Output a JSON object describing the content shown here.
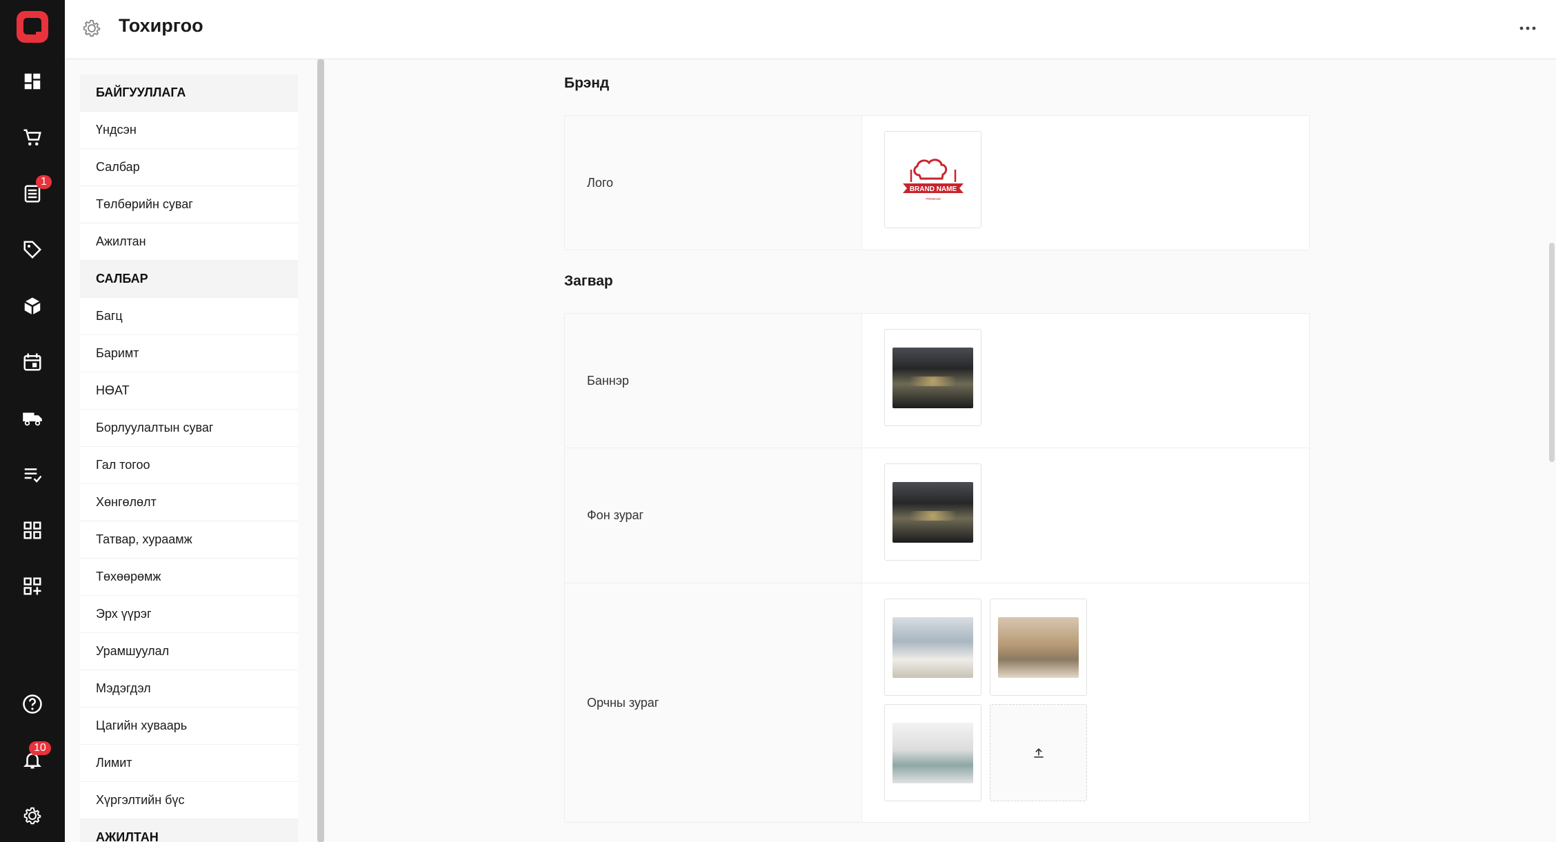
{
  "header": {
    "title": "Тохиргоо"
  },
  "rail": {
    "orders_badge": "1",
    "notifications_badge": "10"
  },
  "menu": {
    "items": [
      {
        "label": "БАЙГУУЛЛАГА",
        "section": true
      },
      {
        "label": "Үндсэн"
      },
      {
        "label": "Салбар"
      },
      {
        "label": "Төлбөрийн суваг"
      },
      {
        "label": "Ажилтан"
      },
      {
        "label": "САЛБАР",
        "section": true
      },
      {
        "label": "Багц"
      },
      {
        "label": "Баримт"
      },
      {
        "label": "НӨАТ"
      },
      {
        "label": "Борлуулалтын суваг"
      },
      {
        "label": "Гал тогоо"
      },
      {
        "label": "Хөнгөлөлт"
      },
      {
        "label": "Татвар, хураамж"
      },
      {
        "label": "Төхөөрөмж"
      },
      {
        "label": "Эрх үүрэг"
      },
      {
        "label": "Урамшуулал"
      },
      {
        "label": "Мэдэгдэл"
      },
      {
        "label": "Цагийн хуваарь"
      },
      {
        "label": "Лимит"
      },
      {
        "label": "Хүргэлтийн бүс"
      },
      {
        "label": "АЖИЛТАН",
        "section": true
      }
    ]
  },
  "brand": {
    "title": "Брэнд",
    "logo_label": "Лого",
    "logo_text": "BRAND NAME",
    "logo_sub": "PREMIUM"
  },
  "design": {
    "title": "Загвар",
    "banner_label": "Баннэр",
    "background_label": "Фон зураг",
    "room_label": "Орчны зураг"
  },
  "colors": {
    "accent": "#e8323c",
    "rail": "#141414"
  }
}
